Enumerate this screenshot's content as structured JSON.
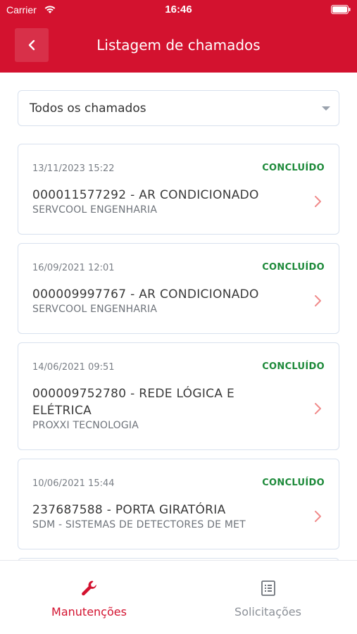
{
  "status_bar": {
    "carrier": "Carrier",
    "time": "16:46"
  },
  "nav": {
    "title": "Listagem de chamados",
    "back_icon": "chevron-left-icon"
  },
  "filter": {
    "selected": "Todos os chamados"
  },
  "tickets": [
    {
      "date": "13/11/2023 15:22",
      "status": "CONCLUÍDO",
      "title": "000011577292 - AR CONDICIONADO",
      "company": "SERVCOOL ENGENHARIA"
    },
    {
      "date": "16/09/2021 12:01",
      "status": "CONCLUÍDO",
      "title": "000009997767 - AR CONDICIONADO",
      "company": "SERVCOOL ENGENHARIA"
    },
    {
      "date": "14/06/2021 09:51",
      "status": "CONCLUÍDO",
      "title": "000009752780 - REDE LÓGICA E ELÉTRICA",
      "company": "PROXXI TECNOLOGIA"
    },
    {
      "date": "10/06/2021 15:44",
      "status": "CONCLUÍDO",
      "title": "237687588 - PORTA GIRATÓRIA",
      "company": "SDM - SISTEMAS DE DETECTORES DE MET"
    }
  ],
  "tabs": [
    {
      "label": "Manutenções",
      "icon": "wrench-icon",
      "active": true
    },
    {
      "label": "Solicitações",
      "icon": "list-icon",
      "active": false
    }
  ],
  "colors": {
    "brand": "#d3122f",
    "status_done": "#1d8a3a",
    "chevron": "#f08a8a"
  }
}
